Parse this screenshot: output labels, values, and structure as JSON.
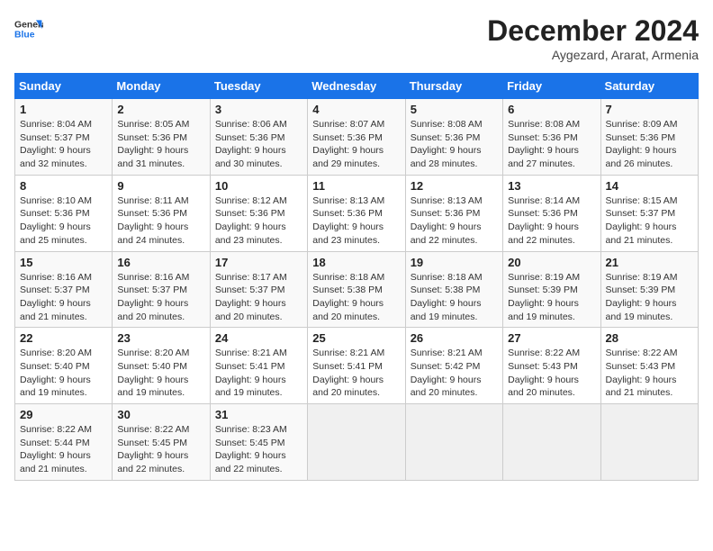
{
  "header": {
    "logo_line1": "General",
    "logo_line2": "Blue",
    "month": "December 2024",
    "location": "Aygezard, Ararat, Armenia"
  },
  "weekdays": [
    "Sunday",
    "Monday",
    "Tuesday",
    "Wednesday",
    "Thursday",
    "Friday",
    "Saturday"
  ],
  "weeks": [
    [
      {
        "day": "1",
        "sunrise": "8:04 AM",
        "sunset": "5:37 PM",
        "daylight": "9 hours and 32 minutes."
      },
      {
        "day": "2",
        "sunrise": "8:05 AM",
        "sunset": "5:36 PM",
        "daylight": "9 hours and 31 minutes."
      },
      {
        "day": "3",
        "sunrise": "8:06 AM",
        "sunset": "5:36 PM",
        "daylight": "9 hours and 30 minutes."
      },
      {
        "day": "4",
        "sunrise": "8:07 AM",
        "sunset": "5:36 PM",
        "daylight": "9 hours and 29 minutes."
      },
      {
        "day": "5",
        "sunrise": "8:08 AM",
        "sunset": "5:36 PM",
        "daylight": "9 hours and 28 minutes."
      },
      {
        "day": "6",
        "sunrise": "8:08 AM",
        "sunset": "5:36 PM",
        "daylight": "9 hours and 27 minutes."
      },
      {
        "day": "7",
        "sunrise": "8:09 AM",
        "sunset": "5:36 PM",
        "daylight": "9 hours and 26 minutes."
      }
    ],
    [
      {
        "day": "8",
        "sunrise": "8:10 AM",
        "sunset": "5:36 PM",
        "daylight": "9 hours and 25 minutes."
      },
      {
        "day": "9",
        "sunrise": "8:11 AM",
        "sunset": "5:36 PM",
        "daylight": "9 hours and 24 minutes."
      },
      {
        "day": "10",
        "sunrise": "8:12 AM",
        "sunset": "5:36 PM",
        "daylight": "9 hours and 23 minutes."
      },
      {
        "day": "11",
        "sunrise": "8:13 AM",
        "sunset": "5:36 PM",
        "daylight": "9 hours and 23 minutes."
      },
      {
        "day": "12",
        "sunrise": "8:13 AM",
        "sunset": "5:36 PM",
        "daylight": "9 hours and 22 minutes."
      },
      {
        "day": "13",
        "sunrise": "8:14 AM",
        "sunset": "5:36 PM",
        "daylight": "9 hours and 22 minutes."
      },
      {
        "day": "14",
        "sunrise": "8:15 AM",
        "sunset": "5:37 PM",
        "daylight": "9 hours and 21 minutes."
      }
    ],
    [
      {
        "day": "15",
        "sunrise": "8:16 AM",
        "sunset": "5:37 PM",
        "daylight": "9 hours and 21 minutes."
      },
      {
        "day": "16",
        "sunrise": "8:16 AM",
        "sunset": "5:37 PM",
        "daylight": "9 hours and 20 minutes."
      },
      {
        "day": "17",
        "sunrise": "8:17 AM",
        "sunset": "5:37 PM",
        "daylight": "9 hours and 20 minutes."
      },
      {
        "day": "18",
        "sunrise": "8:18 AM",
        "sunset": "5:38 PM",
        "daylight": "9 hours and 20 minutes."
      },
      {
        "day": "19",
        "sunrise": "8:18 AM",
        "sunset": "5:38 PM",
        "daylight": "9 hours and 19 minutes."
      },
      {
        "day": "20",
        "sunrise": "8:19 AM",
        "sunset": "5:39 PM",
        "daylight": "9 hours and 19 minutes."
      },
      {
        "day": "21",
        "sunrise": "8:19 AM",
        "sunset": "5:39 PM",
        "daylight": "9 hours and 19 minutes."
      }
    ],
    [
      {
        "day": "22",
        "sunrise": "8:20 AM",
        "sunset": "5:40 PM",
        "daylight": "9 hours and 19 minutes."
      },
      {
        "day": "23",
        "sunrise": "8:20 AM",
        "sunset": "5:40 PM",
        "daylight": "9 hours and 19 minutes."
      },
      {
        "day": "24",
        "sunrise": "8:21 AM",
        "sunset": "5:41 PM",
        "daylight": "9 hours and 19 minutes."
      },
      {
        "day": "25",
        "sunrise": "8:21 AM",
        "sunset": "5:41 PM",
        "daylight": "9 hours and 20 minutes."
      },
      {
        "day": "26",
        "sunrise": "8:21 AM",
        "sunset": "5:42 PM",
        "daylight": "9 hours and 20 minutes."
      },
      {
        "day": "27",
        "sunrise": "8:22 AM",
        "sunset": "5:43 PM",
        "daylight": "9 hours and 20 minutes."
      },
      {
        "day": "28",
        "sunrise": "8:22 AM",
        "sunset": "5:43 PM",
        "daylight": "9 hours and 21 minutes."
      }
    ],
    [
      {
        "day": "29",
        "sunrise": "8:22 AM",
        "sunset": "5:44 PM",
        "daylight": "9 hours and 21 minutes."
      },
      {
        "day": "30",
        "sunrise": "8:22 AM",
        "sunset": "5:45 PM",
        "daylight": "9 hours and 22 minutes."
      },
      {
        "day": "31",
        "sunrise": "8:23 AM",
        "sunset": "5:45 PM",
        "daylight": "9 hours and 22 minutes."
      },
      null,
      null,
      null,
      null
    ]
  ]
}
